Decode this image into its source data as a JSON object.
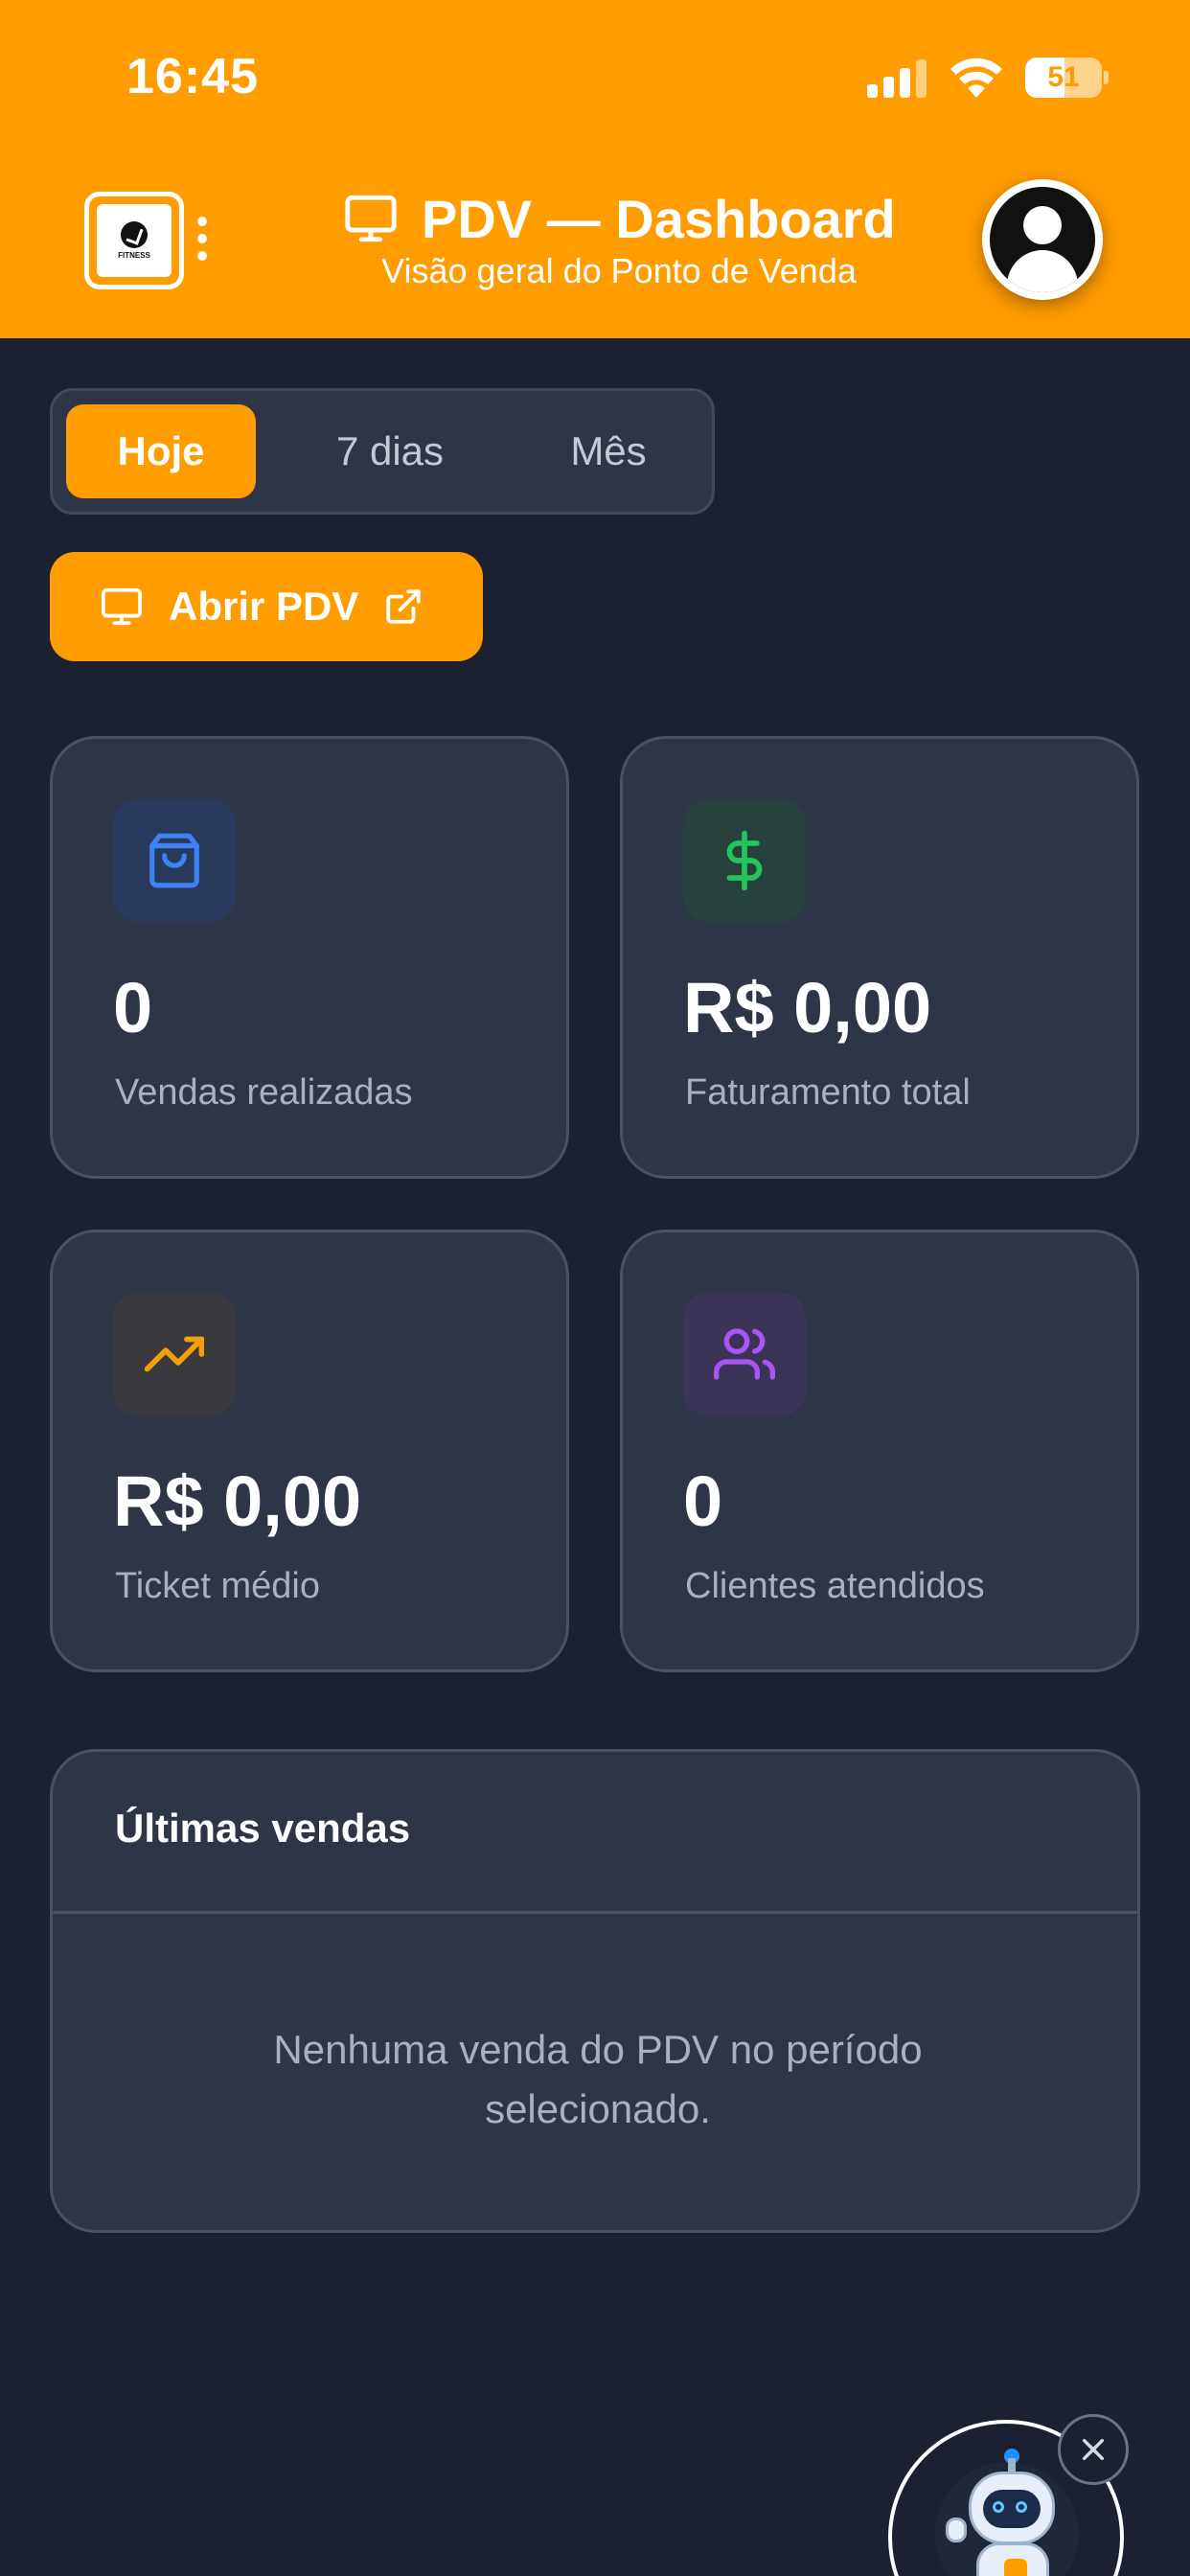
{
  "status_bar": {
    "time": "16:45",
    "battery": "51",
    "battery_level": 0.51
  },
  "header": {
    "logo_text": "FITNESS",
    "title": "PDV — Dashboard",
    "subtitle": "Visão geral do Ponto de Venda",
    "background_color": "#ff9c00"
  },
  "period_tabs": [
    {
      "label": "Hoje",
      "active": true
    },
    {
      "label": "7 dias",
      "active": false
    },
    {
      "label": "Mês",
      "active": false
    }
  ],
  "open_pdv_button": {
    "label": "Abrir PDV",
    "icon": "monitor-icon",
    "trailing_icon": "external-link-icon"
  },
  "stats": [
    {
      "value": "0",
      "label": "Vendas realizadas",
      "icon": "shopping-bag-icon",
      "color": "#3b82f6"
    },
    {
      "value": "R$ 0,00",
      "label": "Faturamento total",
      "icon": "dollar-icon",
      "color": "#22c55e"
    },
    {
      "value": "R$ 0,00",
      "label": "Ticket médio",
      "icon": "trending-up-icon",
      "color": "#f59e0b"
    },
    {
      "value": "0",
      "label": "Clientes atendidos",
      "icon": "users-icon",
      "color": "#a855f7"
    }
  ],
  "latest_sales": {
    "title": "Últimas vendas",
    "empty_message": "Nenhuma venda do PDV no período selecionado."
  },
  "colors": {
    "accent": "#ff9c00",
    "background": "#1b2130",
    "card": "#2d3546",
    "card_border": "#475264",
    "muted_text": "#a9b1bd"
  }
}
